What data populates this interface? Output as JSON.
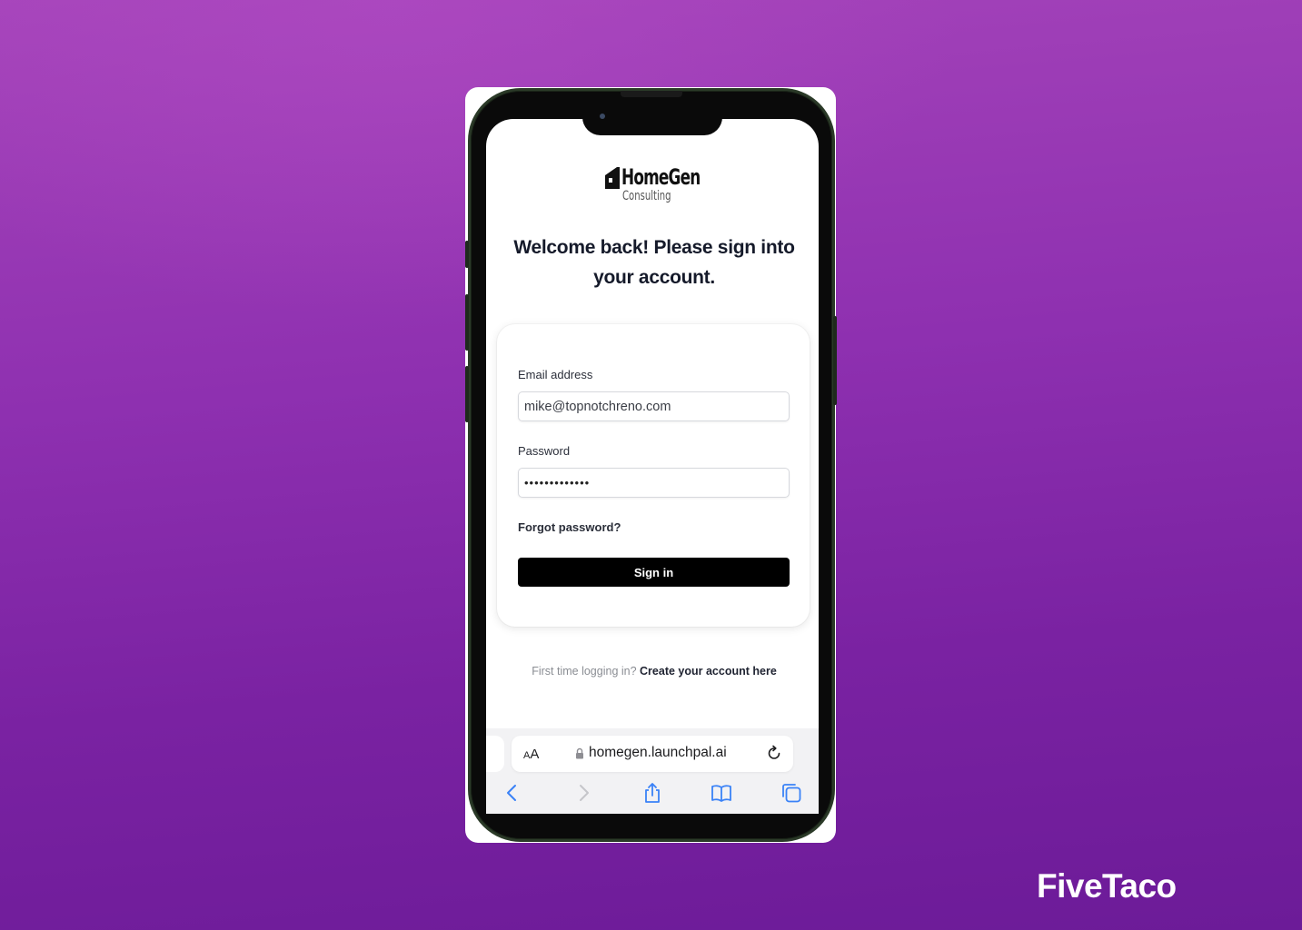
{
  "background": {
    "gradient_top": "#a544ba",
    "gradient_bottom": "#6c1b98"
  },
  "device": {
    "type": "smartphone",
    "frame_color": "#2b3a28"
  },
  "app": {
    "logo": {
      "icon": "house-icon",
      "name": "HomeGen",
      "subtitle": "Consulting"
    },
    "heading": "Welcome back! Please sign into your account.",
    "form": {
      "email": {
        "label": "Email address",
        "value": "mike@topnotchreno.com"
      },
      "password": {
        "label": "Password",
        "value": "•••••••••••••"
      },
      "forgot_password_label": "Forgot password?",
      "submit_label": "Sign in",
      "submit_color": "#000000"
    },
    "footer": {
      "prompt": "First time logging in?",
      "link_label": "Create your account here"
    }
  },
  "browser": {
    "text_size_label_small": "A",
    "text_size_label_large": "A",
    "lock_icon": "lock-icon",
    "url": "homegen.launchpal.ai",
    "reload_icon": "reload-icon",
    "toolbar": [
      {
        "name": "back",
        "icon": "chevron-left-icon",
        "enabled": true
      },
      {
        "name": "forward",
        "icon": "chevron-right-icon",
        "enabled": false
      },
      {
        "name": "share",
        "icon": "share-icon",
        "enabled": true
      },
      {
        "name": "bookmarks",
        "icon": "book-icon",
        "enabled": true
      },
      {
        "name": "tabs",
        "icon": "tabs-icon",
        "enabled": true
      }
    ],
    "accent_color": "#3a82f7"
  },
  "watermark": {
    "brand": "FiveTaco"
  }
}
